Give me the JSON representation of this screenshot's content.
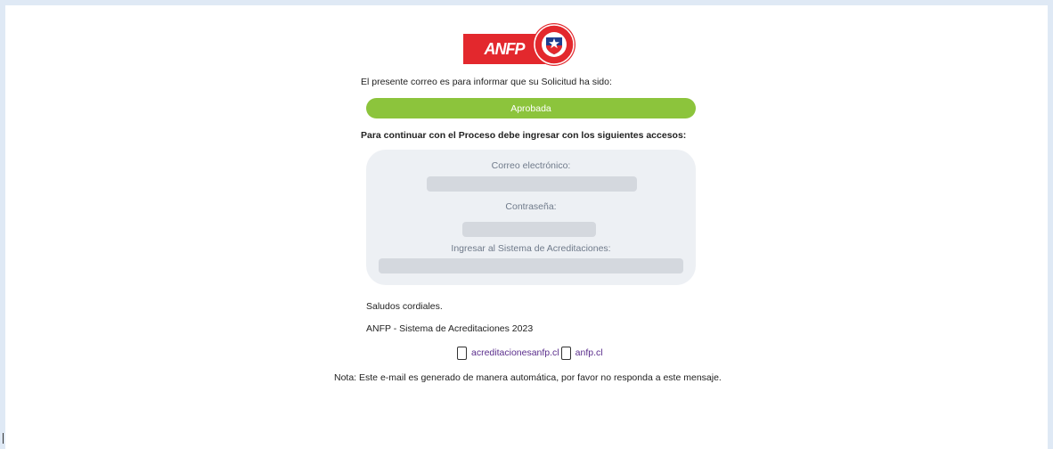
{
  "colors": {
    "background": "#dfe9f5",
    "status_green": "#8cc43c",
    "anfp_red": "#e3282d",
    "card_gray": "#edf0f4",
    "link_purple": "#5a2d8c"
  },
  "logo": {
    "text": "ANFP",
    "seal_icon": "chilean-star-shield-icon"
  },
  "email": {
    "intro": "El presente correo es para informar que su Solicitud ha sido:",
    "status": "Aprobada",
    "instructions": "Para continuar con el Proceso debe ingresar con los siguientes accesos:",
    "credentials": {
      "email_label": "Correo electrónico:",
      "password_label": "Contraseña:",
      "system_label": "Ingresar al Sistema de Acreditaciones:"
    },
    "greeting": "Saludos cordiales.",
    "signature": "ANFP - Sistema de Acreditaciones 2023",
    "links": [
      {
        "label": "acreditacionesanfp.cl",
        "icon": "broken-image-icon"
      },
      {
        "label": "anfp.cl",
        "icon": "broken-image-icon"
      }
    ],
    "note": "Nota: Este e-mail es generado de manera automática, por favor no responda a este mensaje."
  }
}
